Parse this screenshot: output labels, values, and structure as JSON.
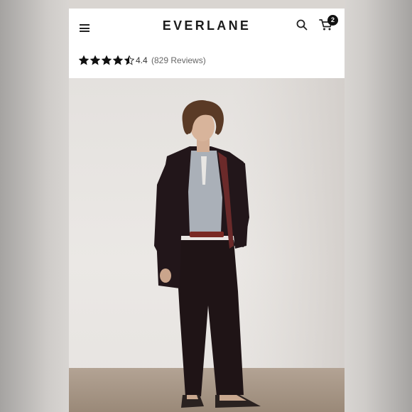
{
  "header": {
    "brand": "EVERLANE",
    "menu_icon": "hamburger-menu-icon",
    "search_icon": "search-icon",
    "cart_icon": "cart-icon",
    "cart_count": "2"
  },
  "rating": {
    "value": "4.4",
    "reviews": "(829 Reviews)",
    "stars_filled": 4,
    "stars_half": 1,
    "stars_total": 5
  },
  "product_image": {
    "subject": "model wearing dark oversized blazer and trousers"
  },
  "colors": {
    "star": "#111111",
    "badge": "#111111",
    "suit": "#1f1416"
  }
}
